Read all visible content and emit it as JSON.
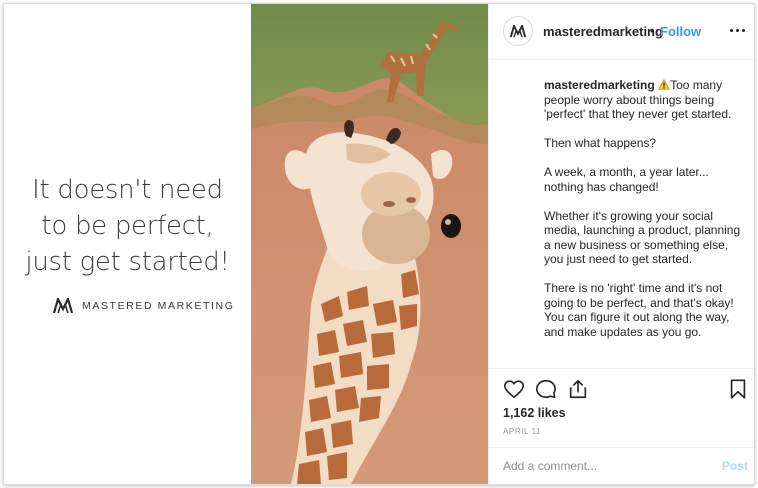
{
  "quote": {
    "line1": "It doesn't need",
    "line2": "to be perfect,",
    "line3": "just get started!"
  },
  "brand": {
    "name": "MASTERED MARKETING",
    "logo_icon": "mm-logo-icon"
  },
  "post": {
    "username": "masteredmarketing",
    "separator": "•",
    "follow_label": "Follow",
    "more_icon": "more-options-icon",
    "caption": {
      "username": "masteredmarketing",
      "warning_icon": "warning-emoji",
      "paragraphs": [
        "Too many people worry about things being 'perfect' that they never get started.",
        "Then what happens?",
        "A week, a month, a year later... nothing has changed!",
        "Whether it's growing your social media, launching a product, planning a new business or something else, you just need to get started.",
        "There is no 'right' time and it's not going to be perfect, and that's okay! You can figure it out along the way, and make updates as you go."
      ]
    },
    "likes": "1,162 likes",
    "date": "APRIL 11",
    "comment_placeholder": "Add a comment...",
    "post_label": "Post"
  },
  "colors": {
    "accent": "#3897f0",
    "post_disabled": "#b3dbff",
    "text": "#262626",
    "muted": "#8e8e8e"
  }
}
